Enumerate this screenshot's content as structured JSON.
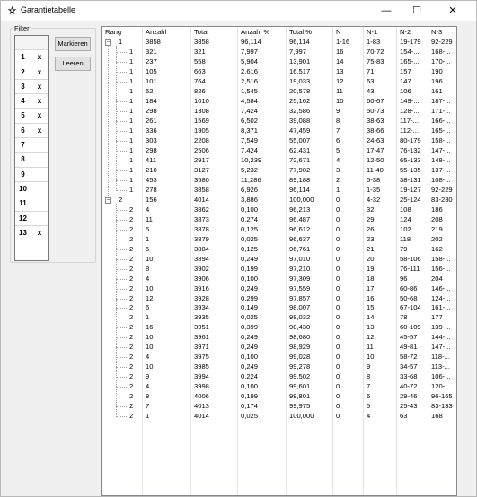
{
  "window": {
    "title": "Garantietabelle"
  },
  "titlebar": {
    "minimize": "—",
    "maximize": "☐",
    "close": "✕"
  },
  "filter": {
    "legend": "Filter",
    "rows": [
      {
        "num": "1",
        "mark": "x"
      },
      {
        "num": "2",
        "mark": "x"
      },
      {
        "num": "3",
        "mark": "x"
      },
      {
        "num": "4",
        "mark": "x"
      },
      {
        "num": "5",
        "mark": "x"
      },
      {
        "num": "6",
        "mark": "x"
      },
      {
        "num": "7",
        "mark": ""
      },
      {
        "num": "8",
        "mark": ""
      },
      {
        "num": "9",
        "mark": ""
      },
      {
        "num": "10",
        "mark": ""
      },
      {
        "num": "11",
        "mark": ""
      },
      {
        "num": "12",
        "mark": ""
      },
      {
        "num": "13",
        "mark": "x"
      }
    ],
    "markieren_label": "Markieren",
    "leeren_label": "Leeren"
  },
  "table": {
    "columns": [
      "Rang",
      "Anzahl",
      "Total",
      "Anzahl %",
      "Total %",
      "N",
      "N-1",
      "N-2",
      "N-3"
    ],
    "rows": [
      {
        "level": 0,
        "expander": "−",
        "rang": "1",
        "anzahl": "3858",
        "total": "3858",
        "anzahl_pct": "96,114",
        "total_pct": "96,114",
        "n": "1-16",
        "n1": "1-83",
        "n2": "19-179",
        "n3": "92-229"
      },
      {
        "level": 1,
        "rang": "1",
        "anzahl": "321",
        "total": "321",
        "anzahl_pct": "7,997",
        "total_pct": "7,997",
        "n": "16",
        "n1": "70-72",
        "n2": "154-...",
        "n3": "168-..."
      },
      {
        "level": 1,
        "rang": "1",
        "anzahl": "237",
        "total": "558",
        "anzahl_pct": "5,904",
        "total_pct": "13,901",
        "n": "14",
        "n1": "75-83",
        "n2": "165-...",
        "n3": "170-..."
      },
      {
        "level": 1,
        "rang": "1",
        "anzahl": "105",
        "total": "663",
        "anzahl_pct": "2,616",
        "total_pct": "16,517",
        "n": "13",
        "n1": "71",
        "n2": "157",
        "n3": "190"
      },
      {
        "level": 1,
        "rang": "1",
        "anzahl": "101",
        "total": "764",
        "anzahl_pct": "2,516",
        "total_pct": "19,033",
        "n": "12",
        "n1": "63",
        "n2": "147",
        "n3": "196"
      },
      {
        "level": 1,
        "rang": "1",
        "anzahl": "62",
        "total": "826",
        "anzahl_pct": "1,545",
        "total_pct": "20,578",
        "n": "11",
        "n1": "43",
        "n2": "106",
        "n3": "161"
      },
      {
        "level": 1,
        "rang": "1",
        "anzahl": "184",
        "total": "1010",
        "anzahl_pct": "4,584",
        "total_pct": "25,162",
        "n": "10",
        "n1": "60-67",
        "n2": "149-...",
        "n3": "187-..."
      },
      {
        "level": 1,
        "rang": "1",
        "anzahl": "298",
        "total": "1308",
        "anzahl_pct": "7,424",
        "total_pct": "32,586",
        "n": "9",
        "n1": "50-73",
        "n2": "128-...",
        "n3": "171-..."
      },
      {
        "level": 1,
        "rang": "1",
        "anzahl": "261",
        "total": "1569",
        "anzahl_pct": "6,502",
        "total_pct": "39,088",
        "n": "8",
        "n1": "38-63",
        "n2": "117-...",
        "n3": "166-..."
      },
      {
        "level": 1,
        "rang": "1",
        "anzahl": "336",
        "total": "1905",
        "anzahl_pct": "8,371",
        "total_pct": "47,459",
        "n": "7",
        "n1": "38-66",
        "n2": "112-...",
        "n3": "165-..."
      },
      {
        "level": 1,
        "rang": "1",
        "anzahl": "303",
        "total": "2208",
        "anzahl_pct": "7,549",
        "total_pct": "55,007",
        "n": "6",
        "n1": "24-63",
        "n2": "80-179",
        "n3": "158-..."
      },
      {
        "level": 1,
        "rang": "1",
        "anzahl": "298",
        "total": "2506",
        "anzahl_pct": "7,424",
        "total_pct": "62,431",
        "n": "5",
        "n1": "17-47",
        "n2": "76-132",
        "n3": "147-..."
      },
      {
        "level": 1,
        "rang": "1",
        "anzahl": "411",
        "total": "2917",
        "anzahl_pct": "10,239",
        "total_pct": "72,671",
        "n": "4",
        "n1": "12-50",
        "n2": "65-133",
        "n3": "148-..."
      },
      {
        "level": 1,
        "rang": "1",
        "anzahl": "210",
        "total": "3127",
        "anzahl_pct": "5,232",
        "total_pct": "77,902",
        "n": "3",
        "n1": "11-40",
        "n2": "55-135",
        "n3": "137-..."
      },
      {
        "level": 1,
        "rang": "1",
        "anzahl": "453",
        "total": "3580",
        "anzahl_pct": "11,286",
        "total_pct": "89,188",
        "n": "2",
        "n1": "5-38",
        "n2": "38-131",
        "n3": "108-..."
      },
      {
        "level": 1,
        "rang": "1",
        "anzahl": "278",
        "total": "3858",
        "anzahl_pct": "6,926",
        "total_pct": "96,114",
        "n": "1",
        "n1": "1-35",
        "n2": "19-127",
        "n3": "92-229"
      },
      {
        "level": 0,
        "expander": "−",
        "rang": "2",
        "anzahl": "156",
        "total": "4014",
        "anzahl_pct": "3,886",
        "total_pct": "100,000",
        "n": "0",
        "n1": "4-32",
        "n2": "25-124",
        "n3": "83-230"
      },
      {
        "level": 1,
        "rang": "2",
        "anzahl": "4",
        "total": "3862",
        "anzahl_pct": "0,100",
        "total_pct": "96,213",
        "n": "0",
        "n1": "32",
        "n2": "108",
        "n3": "186"
      },
      {
        "level": 1,
        "rang": "2",
        "anzahl": "11",
        "total": "3873",
        "anzahl_pct": "0,274",
        "total_pct": "96,487",
        "n": "0",
        "n1": "29",
        "n2": "124",
        "n3": "208"
      },
      {
        "level": 1,
        "rang": "2",
        "anzahl": "5",
        "total": "3878",
        "anzahl_pct": "0,125",
        "total_pct": "96,612",
        "n": "0",
        "n1": "26",
        "n2": "102",
        "n3": "219"
      },
      {
        "level": 1,
        "rang": "2",
        "anzahl": "1",
        "total": "3879",
        "anzahl_pct": "0,025",
        "total_pct": "96,637",
        "n": "0",
        "n1": "23",
        "n2": "118",
        "n3": "202"
      },
      {
        "level": 1,
        "rang": "2",
        "anzahl": "5",
        "total": "3884",
        "anzahl_pct": "0,125",
        "total_pct": "96,761",
        "n": "0",
        "n1": "21",
        "n2": "79",
        "n3": "162"
      },
      {
        "level": 1,
        "rang": "2",
        "anzahl": "10",
        "total": "3894",
        "anzahl_pct": "0,249",
        "total_pct": "97,010",
        "n": "0",
        "n1": "20",
        "n2": "58-106",
        "n3": "158-..."
      },
      {
        "level": 1,
        "rang": "2",
        "anzahl": "8",
        "total": "3902",
        "anzahl_pct": "0,199",
        "total_pct": "97,210",
        "n": "0",
        "n1": "19",
        "n2": "76-111",
        "n3": "156-..."
      },
      {
        "level": 1,
        "rang": "2",
        "anzahl": "4",
        "total": "3906",
        "anzahl_pct": "0,100",
        "total_pct": "97,309",
        "n": "0",
        "n1": "18",
        "n2": "96",
        "n3": "204"
      },
      {
        "level": 1,
        "rang": "2",
        "anzahl": "10",
        "total": "3916",
        "anzahl_pct": "0,249",
        "total_pct": "97,559",
        "n": "0",
        "n1": "17",
        "n2": "60-86",
        "n3": "146-..."
      },
      {
        "level": 1,
        "rang": "2",
        "anzahl": "12",
        "total": "3928",
        "anzahl_pct": "0,299",
        "total_pct": "97,857",
        "n": "0",
        "n1": "16",
        "n2": "50-68",
        "n3": "124-..."
      },
      {
        "level": 1,
        "rang": "2",
        "anzahl": "6",
        "total": "3934",
        "anzahl_pct": "0,149",
        "total_pct": "98,007",
        "n": "0",
        "n1": "15",
        "n2": "67-104",
        "n3": "161-..."
      },
      {
        "level": 1,
        "rang": "2",
        "anzahl": "1",
        "total": "3935",
        "anzahl_pct": "0,025",
        "total_pct": "98,032",
        "n": "0",
        "n1": "14",
        "n2": "78",
        "n3": "177"
      },
      {
        "level": 1,
        "rang": "2",
        "anzahl": "16",
        "total": "3951",
        "anzahl_pct": "0,399",
        "total_pct": "98,430",
        "n": "0",
        "n1": "13",
        "n2": "60-109",
        "n3": "139-..."
      },
      {
        "level": 1,
        "rang": "2",
        "anzahl": "10",
        "total": "3961",
        "anzahl_pct": "0,249",
        "total_pct": "98,680",
        "n": "0",
        "n1": "12",
        "n2": "45-57",
        "n3": "144-..."
      },
      {
        "level": 1,
        "rang": "2",
        "anzahl": "10",
        "total": "3971",
        "anzahl_pct": "0,249",
        "total_pct": "98,929",
        "n": "0",
        "n1": "11",
        "n2": "49-81",
        "n3": "147-..."
      },
      {
        "level": 1,
        "rang": "2",
        "anzahl": "4",
        "total": "3975",
        "anzahl_pct": "0,100",
        "total_pct": "99,028",
        "n": "0",
        "n1": "10",
        "n2": "58-72",
        "n3": "118-..."
      },
      {
        "level": 1,
        "rang": "2",
        "anzahl": "10",
        "total": "3985",
        "anzahl_pct": "0,249",
        "total_pct": "99,278",
        "n": "0",
        "n1": "9",
        "n2": "34-57",
        "n3": "113-..."
      },
      {
        "level": 1,
        "rang": "2",
        "anzahl": "9",
        "total": "3994",
        "anzahl_pct": "0,224",
        "total_pct": "99,502",
        "n": "0",
        "n1": "8",
        "n2": "33-68",
        "n3": "106-..."
      },
      {
        "level": 1,
        "rang": "2",
        "anzahl": "4",
        "total": "3998",
        "anzahl_pct": "0,100",
        "total_pct": "99,601",
        "n": "0",
        "n1": "7",
        "n2": "40-72",
        "n3": "120-..."
      },
      {
        "level": 1,
        "rang": "2",
        "anzahl": "8",
        "total": "4006",
        "anzahl_pct": "0,199",
        "total_pct": "99,801",
        "n": "0",
        "n1": "6",
        "n2": "29-46",
        "n3": "96-165"
      },
      {
        "level": 1,
        "rang": "2",
        "anzahl": "7",
        "total": "4013",
        "anzahl_pct": "0,174",
        "total_pct": "99,975",
        "n": "0",
        "n1": "5",
        "n2": "25-43",
        "n3": "83-133"
      },
      {
        "level": 1,
        "rang": "2",
        "anzahl": "1",
        "total": "4014",
        "anzahl_pct": "0,025",
        "total_pct": "100,000",
        "n": "0",
        "n1": "4",
        "n2": "63",
        "n3": "168"
      }
    ]
  }
}
